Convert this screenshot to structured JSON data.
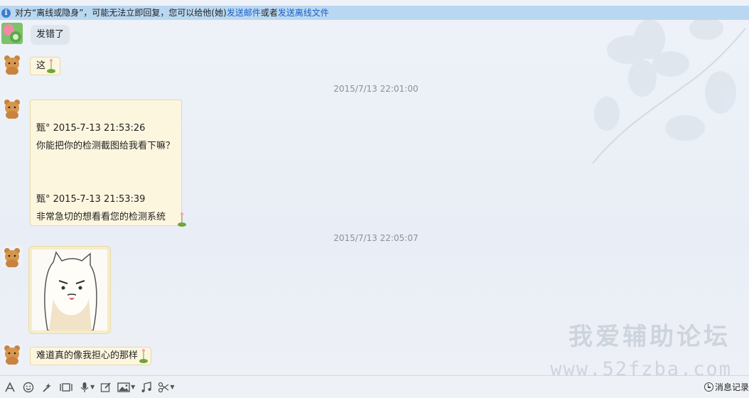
{
  "notice": {
    "text": "对方“离线或隐身”，可能无法立即回复，您可以给他(她)",
    "link_email": "发送邮件",
    "middle": "或者",
    "link_file": "发送离线文件"
  },
  "messages": [
    {
      "text": "发错了",
      "style": "gray"
    },
    {
      "text": "这",
      "style": "cream"
    }
  ],
  "timestamps": [
    "2015/7/13 22:01:00",
    "2015/7/13 22:05:07"
  ],
  "forwarded": [
    {
      "header": "甄° 2015-7-13 21:53:26",
      "body": "你能把你的检测截图给我看下嘛？"
    },
    {
      "header": "甄° 2015-7-13 21:53:39",
      "body": "非常急切的想看看您的检测系统"
    }
  ],
  "last_message": "难道真的像我担心的那样",
  "watermark": {
    "title": "我爱辅助论坛",
    "url": "www.52fzba.com"
  },
  "toolbar": {
    "items": [
      "font-icon",
      "emoji-icon",
      "magic-icon",
      "screenshot-icon",
      "mic-icon",
      "edit-icon",
      "image-icon",
      "music-icon",
      "scissors-icon"
    ],
    "history_label": "消息记录"
  },
  "colors": {
    "notice_bg": "#b9d7f1",
    "link": "#1a5fc6",
    "bubble_cream": "#fdf6df",
    "bubble_gray": "#dfe6ee"
  }
}
